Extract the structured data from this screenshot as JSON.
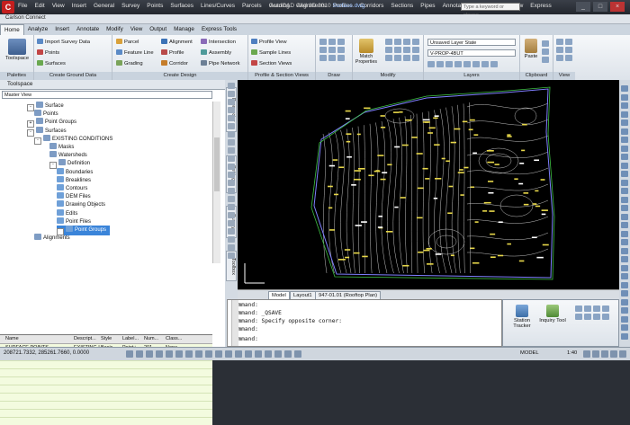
{
  "title_bar": {
    "app_letter": "C",
    "menus": [
      "File",
      "Edit",
      "View",
      "Insert",
      "General",
      "Survey",
      "Points",
      "Surfaces",
      "Lines/Curves",
      "Parcels",
      "Grading",
      "Alignments",
      "Profiles",
      "Corridors",
      "Sections",
      "Pipes",
      "Annotation",
      "Inquiry",
      "Window",
      "Express"
    ],
    "app_title": "AutoCAD Civil 3D 2010",
    "doc_title": "Surface.dwg",
    "search_placeholder": "Type a keyword or phrase",
    "minimize": "_",
    "maximize": "□",
    "close": "×"
  },
  "connect_bar": {
    "label": "Carlson Connect"
  },
  "ribbon_tabs": [
    "Home",
    "Analyze",
    "Insert",
    "Annotate",
    "Modify",
    "View",
    "Output",
    "Manage",
    "Express Tools"
  ],
  "ribbon": {
    "toolspace": "Toolspace",
    "palettes": "Palettes",
    "create_ground_data": {
      "caption": "Create Ground Data",
      "items": [
        "Import Survey Data",
        "Points",
        "Surfaces"
      ]
    },
    "create_design": {
      "caption": "Create Design",
      "items": [
        "Parcel",
        "Feature Line",
        "Grading",
        "Alignment",
        "Profile",
        "Corridor",
        "Intersection",
        "Assembly",
        "Pipe Network"
      ]
    },
    "profile_section": {
      "caption": "Profile & Section Views",
      "items": [
        "Profile View",
        "Sample Lines",
        "Section Views"
      ]
    },
    "draw": "Draw",
    "modify": {
      "caption": "Modify",
      "match": "Match Properties"
    },
    "layers": {
      "caption": "Layers",
      "state": "Unsaved Layer State",
      "current": "V-PROP-4BUT"
    },
    "clipboard": {
      "caption": "Clipboard",
      "paste": "Paste"
    },
    "view": "View"
  },
  "toolspace": {
    "title": "Toolspace",
    "master_view": "Master View",
    "tree": [
      {
        "label": "Surface"
      },
      {
        "label": "Points"
      },
      {
        "label": "Point Groups"
      },
      {
        "label": "Surfaces"
      },
      {
        "label": "EXISTING CONDITIONS"
      },
      {
        "label": "Masks"
      },
      {
        "label": "Watersheds"
      },
      {
        "label": "Definition"
      },
      {
        "label": "Boundaries"
      },
      {
        "label": "Breaklines"
      },
      {
        "label": "Contours"
      },
      {
        "label": "DEM Files"
      },
      {
        "label": "Drawing Objects"
      },
      {
        "label": "Edits"
      },
      {
        "label": "Point Files"
      },
      {
        "label": "Point Groups"
      },
      {
        "label": "Alignments"
      }
    ],
    "side_tabs": [
      "Prospector",
      "Settings",
      "Survey",
      "Toolbox"
    ],
    "grid": {
      "headers": [
        "Name",
        "Descript...",
        "Style",
        "Label...",
        "Num...",
        "Class..."
      ],
      "row": [
        "SURFACE POINTS",
        "EXISTING I",
        "Basic",
        "Point+...",
        "201",
        "None"
      ]
    }
  },
  "layout_tabs": [
    "Model",
    "Layout1",
    "947-01.01 (Rooftop Plan)"
  ],
  "command": {
    "lines": [
      "Command:",
      "Command: _QSAVE",
      "Command: Specify opposite corner:",
      "Command:",
      "Command:"
    ]
  },
  "inquiry": {
    "station_tracker": "Station Tracker",
    "inquiry_tool": "Inquiry Tool"
  },
  "status": {
    "coords": "208721.7332, 285261.7660, 0.0000",
    "model": "MODEL",
    "scale": "1:40"
  },
  "colors": {
    "canvas": "#000000",
    "contour": "#d8d8d8",
    "boundary": "#3ec043",
    "outline": "#7f7fff",
    "label": "#e8d84a",
    "selection": "#3a84d9"
  }
}
